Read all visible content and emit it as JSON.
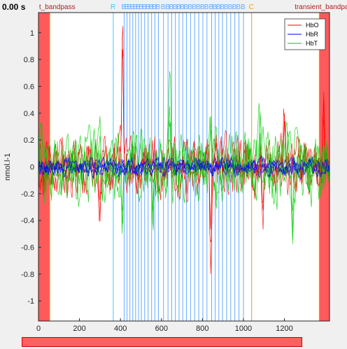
{
  "time_readout": "0.00 s",
  "colors": {
    "hbo": "#ff0000",
    "hbr": "#0000ff",
    "hbt": "#00cc00",
    "event_cyan": "#33ccff",
    "event_blue": "#66aaff",
    "event_orange": "#ff9900",
    "label_dark_red": "#aa2222",
    "exclusion": "#ff5a5a"
  },
  "chart_data": {
    "type": "line",
    "title": "",
    "xlabel": "",
    "ylabel": "nmol.l-1",
    "xlim": [
      0,
      1420
    ],
    "ylim": [
      -1.15,
      1.15
    ],
    "x_ticks": [
      "0",
      "200",
      "400",
      "600",
      "800",
      "1000",
      "1200"
    ],
    "y_ticks": [
      "-1",
      "-0.8",
      "-0.6",
      "-0.4",
      "-0.2",
      "0",
      "0.2",
      "0.4",
      "0.6",
      "0.8",
      "1"
    ],
    "legend": {
      "placement": "top-right",
      "entries": [
        "HbO",
        "HbR",
        "HbT"
      ]
    },
    "series": [
      {
        "name": "HbO",
        "color": "#ff0000",
        "min": -0.83,
        "max": 1.08
      },
      {
        "name": "HbR",
        "color": "#0000ff",
        "min": -0.12,
        "max": 0.15
      },
      {
        "name": "HbT",
        "color": "#00cc00",
        "min": -0.65,
        "max": 0.75
      }
    ],
    "exclusion_regions": [
      {
        "x0": 0,
        "x1": 55
      },
      {
        "x0": 1370,
        "x1": 1420
      }
    ],
    "region_labels": [
      {
        "text": "t_bandpass",
        "x": 3
      },
      {
        "text": "transient_bandpa",
        "x": 1250
      }
    ],
    "event_markers": [
      {
        "label": "R",
        "x": 365,
        "kind": "cyan"
      },
      {
        "label": "B",
        "x": 418,
        "kind": "blue"
      },
      {
        "label": "B",
        "x": 432,
        "kind": "blue"
      },
      {
        "label": "B",
        "x": 446,
        "kind": "blue"
      },
      {
        "label": "B",
        "x": 460,
        "kind": "blue"
      },
      {
        "label": "B",
        "x": 474,
        "kind": "blue"
      },
      {
        "label": "B",
        "x": 488,
        "kind": "blue"
      },
      {
        "label": "B",
        "x": 502,
        "kind": "blue"
      },
      {
        "label": "B",
        "x": 518,
        "kind": "blue"
      },
      {
        "label": "B",
        "x": 535,
        "kind": "blue"
      },
      {
        "label": "B",
        "x": 552,
        "kind": "blue"
      },
      {
        "label": "B",
        "x": 568,
        "kind": "blue"
      },
      {
        "label": "B",
        "x": 585,
        "kind": "blue"
      },
      {
        "label": "B",
        "x": 610,
        "kind": "blue"
      },
      {
        "label": "B",
        "x": 632,
        "kind": "blue"
      },
      {
        "label": "B",
        "x": 650,
        "kind": "blue"
      },
      {
        "label": "B",
        "x": 668,
        "kind": "blue"
      },
      {
        "label": "B",
        "x": 686,
        "kind": "blue"
      },
      {
        "label": "B",
        "x": 704,
        "kind": "blue"
      },
      {
        "label": "B",
        "x": 722,
        "kind": "blue"
      },
      {
        "label": "B",
        "x": 742,
        "kind": "blue"
      },
      {
        "label": "B",
        "x": 762,
        "kind": "blue"
      },
      {
        "label": "B",
        "x": 782,
        "kind": "blue"
      },
      {
        "label": "B",
        "x": 802,
        "kind": "blue"
      },
      {
        "label": "B",
        "x": 822,
        "kind": "blue"
      },
      {
        "label": "B",
        "x": 845,
        "kind": "blue"
      },
      {
        "label": "B",
        "x": 862,
        "kind": "blue"
      },
      {
        "label": "B",
        "x": 880,
        "kind": "blue"
      },
      {
        "label": "B",
        "x": 898,
        "kind": "blue"
      },
      {
        "label": "B",
        "x": 918,
        "kind": "blue"
      },
      {
        "label": "B",
        "x": 938,
        "kind": "blue"
      },
      {
        "label": "B",
        "x": 958,
        "kind": "blue"
      },
      {
        "label": "B",
        "x": 978,
        "kind": "blue"
      },
      {
        "label": "B",
        "x": 1000,
        "kind": "blue"
      },
      {
        "label": "C",
        "x": 1040,
        "kind": "orange"
      }
    ]
  }
}
